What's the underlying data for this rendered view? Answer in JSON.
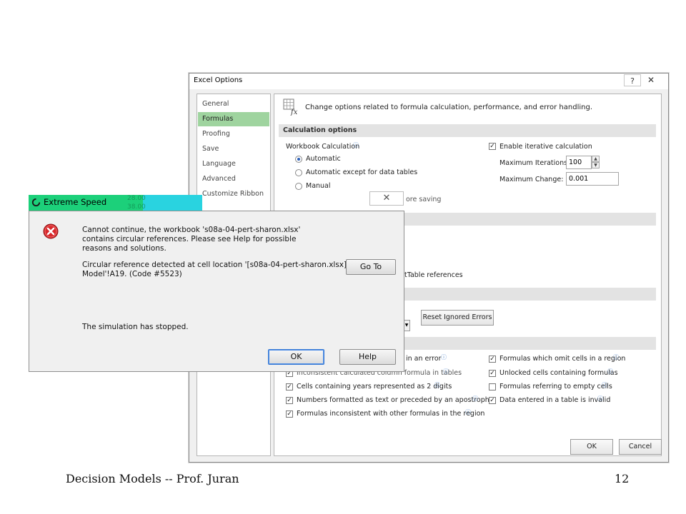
{
  "excel_options": {
    "title": "Excel Options",
    "help_glyph": "?",
    "close_glyph": "✕",
    "sidebar": {
      "items": [
        {
          "label": "General"
        },
        {
          "label": "Formulas"
        },
        {
          "label": "Proofing"
        },
        {
          "label": "Save"
        },
        {
          "label": "Language"
        },
        {
          "label": "Advanced"
        },
        {
          "label": "Customize Ribbon"
        }
      ],
      "active_index": 1,
      "active_color": "#9fd49f"
    },
    "intro_text": "Change options related to formula calculation, performance, and error handling.",
    "calculation": {
      "header": "Calculation options",
      "workbook_calc_label": "Workbook Calculation",
      "options": [
        {
          "label": "Automatic",
          "selected": true
        },
        {
          "label": "Automatic except for data tables",
          "selected": false
        },
        {
          "label": "Manual",
          "selected": false
        }
      ],
      "recalc_before_saving_fragment": "ore saving",
      "enable_iterative_label": "Enable iterative calculation",
      "enable_iterative_checked": true,
      "max_iterations_label": "Maximum Iterations:",
      "max_iterations_value": "100",
      "max_change_label": "Maximum Change:",
      "max_change_value": "0.001"
    },
    "pivot_fragment": "tTable references",
    "reset_ignored_errors_label": "Reset Ignored Errors",
    "error_rules": {
      "left": [
        {
          "label": "in an error",
          "checked": true
        },
        {
          "label": "Inconsistent calculated column formula in tables",
          "checked": true
        },
        {
          "label": "Cells containing years represented as 2 digits",
          "checked": true
        },
        {
          "label": "Numbers formatted as text or preceded by an apostrophe",
          "checked": true
        },
        {
          "label": "Formulas inconsistent with other formulas in the region",
          "checked": true
        }
      ],
      "right": [
        {
          "label": "Formulas which omit cells in a region",
          "checked": true
        },
        {
          "label": "Unlocked cells containing formulas",
          "checked": true
        },
        {
          "label": "Formulas referring to empty cells",
          "checked": false
        },
        {
          "label": "Data entered in a table is invalid",
          "checked": true
        }
      ]
    },
    "ok_label": "OK",
    "cancel_label": "Cancel"
  },
  "chip_glyph": "✕",
  "extreme_speed": {
    "title": "Extreme Speed",
    "title_color": "#1cd07a",
    "ghost_values": [
      "28.00",
      "38.00"
    ],
    "message_lines": [
      "Cannot continue, the workbook 's08a-04-pert-sharon.xlsx'",
      "contains circular references.  Please see Help for possible",
      "reasons and solutions."
    ],
    "circular_lines": [
      "Circular reference detected at cell location '[s08a-04-pert-sharon.xlsx]",
      "Model'!A19.  (Code #5523)"
    ],
    "goto_label": "Go To",
    "stopped_text": "The simulation has stopped.",
    "ok_label": "OK",
    "help_label": "Help"
  },
  "footer": {
    "left": "Decision Models  --  Prof. Juran",
    "page_number": "12"
  }
}
